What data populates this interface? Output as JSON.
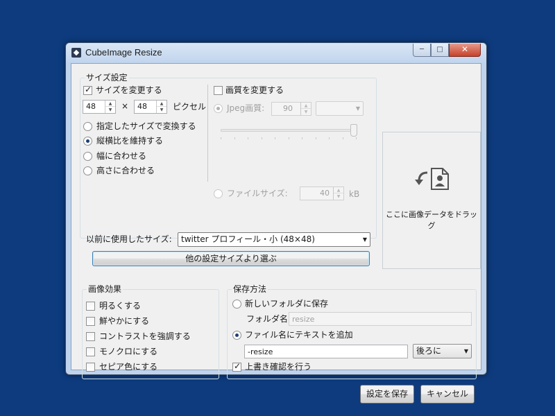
{
  "window": {
    "title": "CubeImage Resize",
    "controls": {
      "minimize": "─",
      "maximize": "□",
      "close": "✕"
    }
  },
  "size_settings": {
    "group_label": "サイズ設定",
    "change_size": {
      "label": "サイズを変更する",
      "checked": true
    },
    "width": "48",
    "times": "×",
    "height": "48",
    "unit": "ピクセル",
    "modes": [
      {
        "label": "指定したサイズで変換する",
        "selected": false
      },
      {
        "label": "縦横比を維持する",
        "selected": true
      },
      {
        "label": "幅に合わせる",
        "selected": false
      },
      {
        "label": "高さに合わせる",
        "selected": false
      }
    ],
    "previous_label": "以前に使用したサイズ:",
    "previous_value": "twitter プロフィール・小 (48×48)",
    "other_button": "他の設定サイズより選ぶ"
  },
  "quality": {
    "change_quality": {
      "label": "画質を変更する",
      "checked": false
    },
    "jpeg_label": "Jpeg画質:",
    "jpeg_value": "90",
    "filesize_label": "ファイルサイズ:",
    "filesize_value": "40",
    "filesize_unit": "kB"
  },
  "drop_area": {
    "text": "ここに画像データをドラッグ",
    "icon": "drop-image-icon"
  },
  "effects": {
    "group_label": "画像効果",
    "items": [
      {
        "label": "明るくする",
        "checked": false
      },
      {
        "label": "鮮やかにする",
        "checked": false
      },
      {
        "label": "コントラストを強調する",
        "checked": false
      },
      {
        "label": "モノクロにする",
        "checked": false
      },
      {
        "label": "セピア色にする",
        "checked": false
      }
    ]
  },
  "save": {
    "group_label": "保存方法",
    "new_folder": {
      "label": "新しいフォルダに保存",
      "selected": false
    },
    "folder_label": "フォルダ名:",
    "folder_value": "resize",
    "add_text": {
      "label": "ファイル名にテキストを追加",
      "selected": true
    },
    "suffix_value": "-resize",
    "position_value": "後ろに",
    "overwrite_confirm": {
      "label": "上書き確認を行う",
      "checked": true
    }
  },
  "buttons": {
    "save_settings": "設定を保存",
    "cancel": "キャンセル"
  },
  "colors": {
    "desktop": "#0d3b7e",
    "window_frame": "#bfd3ec",
    "close_button": "#c7412a"
  }
}
